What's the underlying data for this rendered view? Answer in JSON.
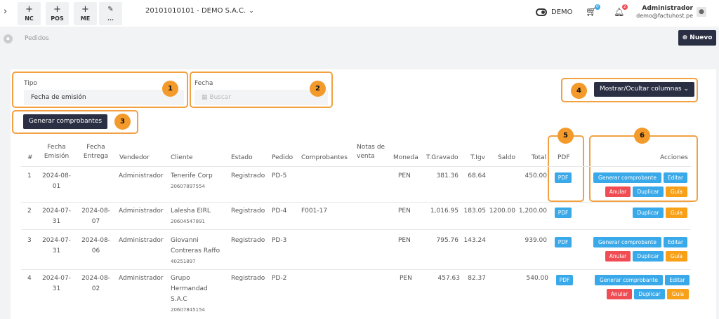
{
  "topbar": {
    "quick_buttons": [
      {
        "label": "NC",
        "icon": "plus-icon"
      },
      {
        "label": "POS",
        "icon": "plus-icon"
      },
      {
        "label": "ME",
        "icon": "plus-icon"
      },
      {
        "label": "...",
        "icon": "pencil-icon"
      }
    ],
    "company": "20101010101 - DEMO S.A.C.",
    "demo_label": "DEMO",
    "cart_count": "0",
    "notif_count": "2",
    "user_name": "Administrador",
    "user_email": "demo@factuhost.pe"
  },
  "breadcrumb": {
    "label": "Pedidos"
  },
  "actions": {
    "new_label": "Nuevo"
  },
  "filters": {
    "tipo_label": "Tipo",
    "tipo_value": "Fecha de emisión",
    "fecha_label": "Fecha",
    "fecha_placeholder": "Buscar",
    "columns_button": "Mostrar/Ocultar columnas",
    "generate_button": "Generar comprobantes"
  },
  "callout_numbers": [
    "1",
    "2",
    "3",
    "4",
    "5",
    "6"
  ],
  "table": {
    "headers": {
      "num": "#",
      "fecha_emision": [
        "Fecha",
        "Emisión"
      ],
      "fecha_entrega": [
        "Fecha",
        "Entrega"
      ],
      "vendedor": "Vendedor",
      "cliente": "Cliente",
      "estado": "Estado",
      "pedido": "Pedido",
      "comprobantes": "Comprobantes",
      "notas": [
        "Notas de",
        "venta"
      ],
      "moneda": "Moneda",
      "t_gravado": "T.Gravado",
      "t_igv": "T.Igv",
      "saldo": "Saldo",
      "total": "Total",
      "pdf": "PDF",
      "acciones": "Acciones"
    },
    "rows": [
      {
        "num": "1",
        "emision": [
          "2024-08-",
          "01"
        ],
        "entrega": [
          "",
          ""
        ],
        "vendedor": "Administrador",
        "cliente": [
          "Tenerife Corp"
        ],
        "doc": "20607897554",
        "estado": "Registrado",
        "pedido": "PD-5",
        "comprobantes": "",
        "moneda": "PEN",
        "gravado": "381.36",
        "igv": "68.64",
        "saldo": "",
        "total": "450.00"
      },
      {
        "num": "2",
        "emision": [
          "2024-07-",
          "31"
        ],
        "entrega": [
          "2024-08-",
          "07"
        ],
        "vendedor": "Administrador",
        "cliente": [
          "Lalesha EIRL"
        ],
        "doc": "20604547891",
        "estado": "Registrado",
        "pedido": "PD-4",
        "comprobantes": "F001-17",
        "moneda": "PEN",
        "gravado": "1,016.95",
        "igv": "183.05",
        "saldo": "1200.00",
        "total": "1,200.00"
      },
      {
        "num": "3",
        "emision": [
          "2024-07-",
          "31"
        ],
        "entrega": [
          "2024-08-",
          "06"
        ],
        "vendedor": "Administrador",
        "cliente": [
          "Giovanni",
          "Contreras Raffo"
        ],
        "doc": "40251897",
        "estado": "Registrado",
        "pedido": "PD-3",
        "comprobantes": "",
        "moneda": "PEN",
        "gravado": "795.76",
        "igv": "143.24",
        "saldo": "",
        "total": "939.00"
      },
      {
        "num": "4",
        "emision": [
          "2024-07-",
          "31"
        ],
        "entrega": [
          "2024-08-",
          "02"
        ],
        "vendedor": "Administrador",
        "cliente": [
          "Grupo",
          "Hermandad",
          "S.A.C"
        ],
        "doc": "20607845154",
        "estado": "Registrado",
        "pedido": "PD-2",
        "comprobantes": "",
        "moneda": "PEN",
        "gravado": "457.63",
        "igv": "82.37",
        "saldo": "",
        "total": "540.00"
      }
    ],
    "pdf_label": "PDF",
    "action_labels": {
      "generar": "Generar comprobante",
      "editar": "Editar",
      "anular": "Anular",
      "duplicar": "Duplicar",
      "guia": "Guía"
    }
  },
  "colors": {
    "dark": "#2b2f43",
    "orange": "#f39a2b",
    "blue": "#39a9e9",
    "red": "#ef4d53"
  }
}
